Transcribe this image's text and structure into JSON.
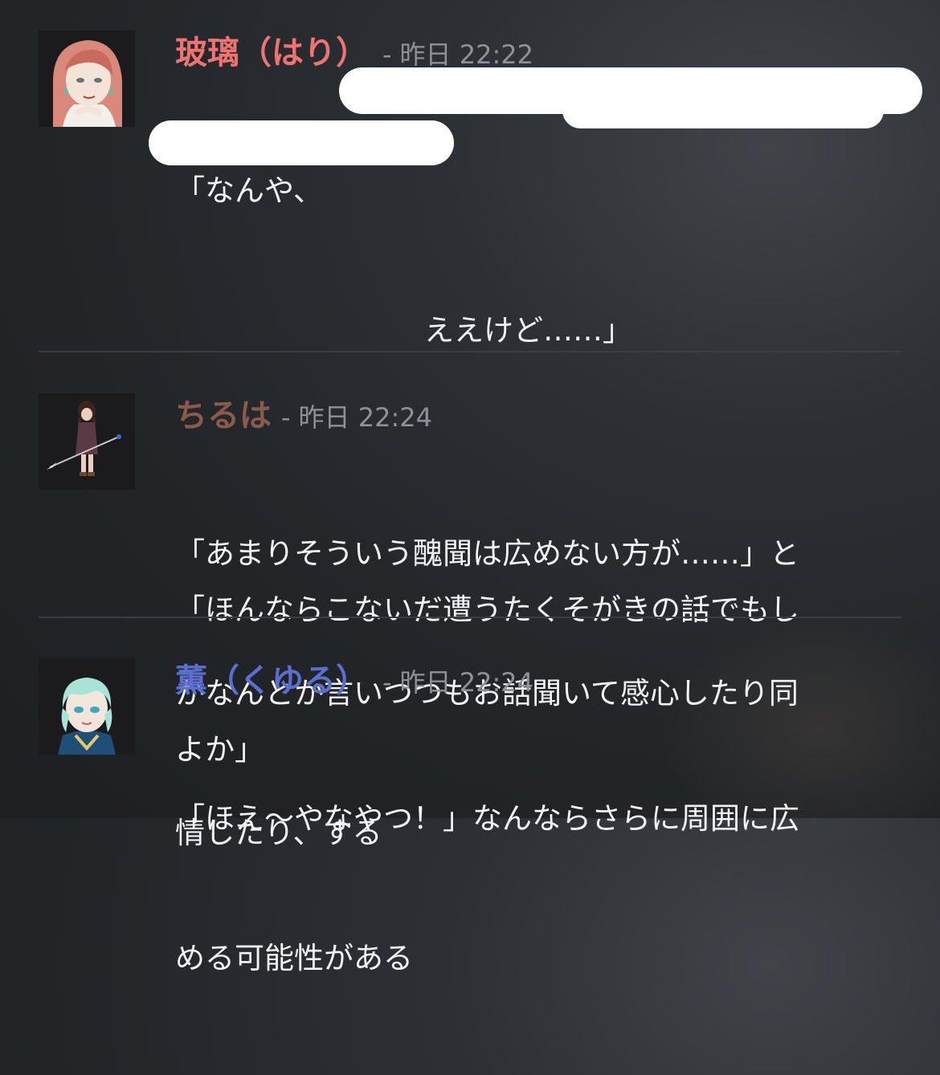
{
  "messages": [
    {
      "username": "玻璃（はり）",
      "username_color": "#f07272",
      "separator": "-",
      "timestamp": "昨日 22:22",
      "lines": [
        "「なんや、",
        "ええけど……」",
        "",
        "「ほんならこないだ遭うたくそがきの話でもし",
        "よか」"
      ],
      "avatar_icon": "character-avatar-hari"
    },
    {
      "username": "ちるは",
      "username_color": "#8a5a4a",
      "separator": "-",
      "timestamp": "昨日 22:24",
      "lines": [
        "「あまりそういう醜聞は広めない方が……」と",
        "かなんとか言いつつもお話聞いて感心したり同",
        "情したり、する"
      ],
      "avatar_icon": "character-avatar-chiruha"
    },
    {
      "username": "薫（くゆる）",
      "username_color": "#5b6fd0",
      "separator": "-",
      "timestamp": "昨日 22:24",
      "lines": [
        "「ほえ〜やなやつ！」なんならさらに周囲に広",
        "める可能性がある"
      ],
      "avatar_icon": "character-avatar-kuyuru"
    }
  ],
  "colors": {
    "timestamp": "#8e9297",
    "divider": "#3a3d41",
    "text": "#f2f3f5"
  }
}
